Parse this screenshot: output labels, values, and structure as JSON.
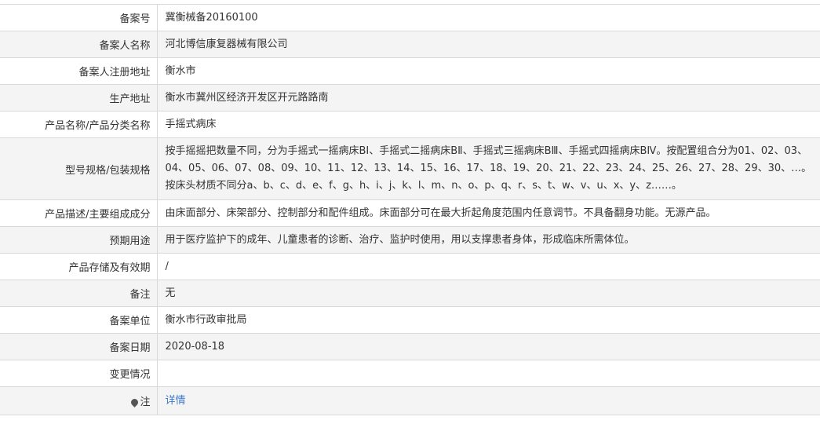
{
  "rows": [
    {
      "label": "备案号",
      "value": "冀衡械备20160100"
    },
    {
      "label": "备案人名称",
      "value": "河北博信康复器械有限公司"
    },
    {
      "label": "备案人注册地址",
      "value": "衡水市"
    },
    {
      "label": "生产地址",
      "value": "衡水市冀州区经济开发区开元路路南"
    },
    {
      "label": "产品名称/产品分类名称",
      "value": "手摇式病床"
    },
    {
      "label": "型号规格/包装规格",
      "value": "按手摇摇把数量不同，分为手摇式一摇病床BⅠ、手摇式二摇病床BⅡ、手摇式三摇病床BⅢ、手摇式四摇病床BⅣ。按配置组合分为01、02、03、04、05、06、07、08、09、10、11、12、13、14、15、16、17、18、19、20、21、22、23、24、25、26、27、28、29、30、…。按床头材质不同分a、b、c、d、e、f、g、h、i、j、k、l、m、n、o、p、q、r、s、t、w、v、u、x、y、z……。"
    },
    {
      "label": "产品描述/主要组成成分",
      "value": "由床面部分、床架部分、控制部分和配件组成。床面部分可在最大折起角度范围内任意调节。不具备翻身功能。无源产品。"
    },
    {
      "label": "预期用途",
      "value": "用于医疗监护下的成年、儿童患者的诊断、治疗、监护时使用，用以支撑患者身体，形成临床所需体位。"
    },
    {
      "label": "产品存储及有效期",
      "value": "/"
    },
    {
      "label": "备注",
      "value": "无"
    },
    {
      "label": "备案单位",
      "value": "衡水市行政审批局"
    },
    {
      "label": "备案日期",
      "value": "2020-08-18"
    },
    {
      "label": "变更情况",
      "value": ""
    }
  ],
  "note": {
    "icon": "pin-icon",
    "label": "注",
    "link_text": "详情"
  }
}
